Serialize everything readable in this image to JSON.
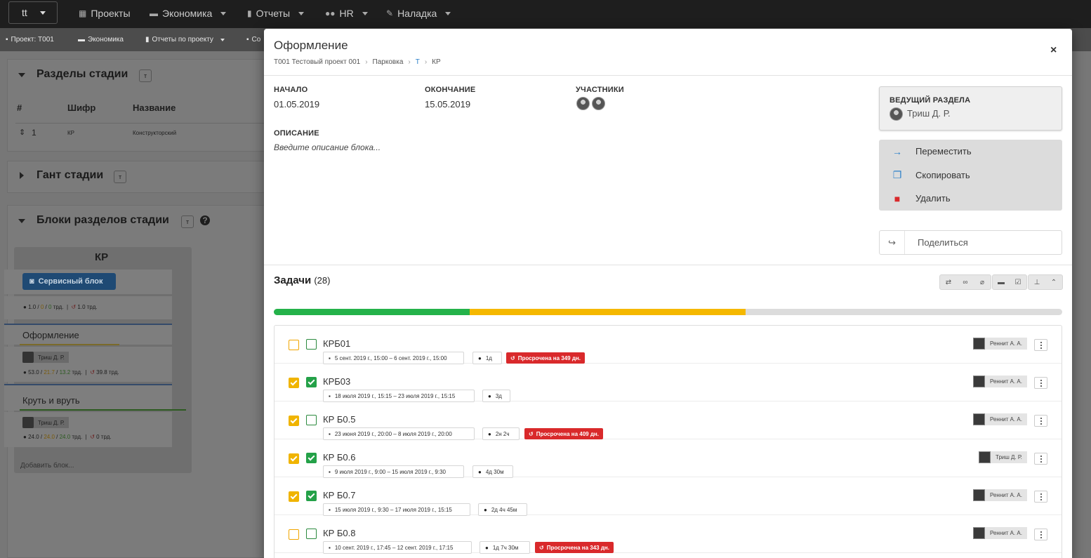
{
  "nav": {
    "project": "tt",
    "items": [
      {
        "icon": "grid-icon",
        "label": "Проекты",
        "dropdown": false
      },
      {
        "icon": "money-icon",
        "label": "Экономика",
        "dropdown": true
      },
      {
        "icon": "clipboard-icon",
        "label": "Отчеты",
        "dropdown": true
      },
      {
        "icon": "users-icon",
        "label": "HR",
        "dropdown": true
      },
      {
        "icon": "wrench-icon",
        "label": "Наладка",
        "dropdown": true
      }
    ]
  },
  "subnav": {
    "items": [
      "Проект: Т001",
      "Экономика",
      "Отчеты по проекту",
      "Co"
    ]
  },
  "background": {
    "sections_title": "Разделы стадии",
    "t_badge": "т",
    "table_headers": [
      "#",
      "Шифр",
      "Название"
    ],
    "row": {
      "num": "1",
      "code": "КР",
      "name": "Конструкторский"
    },
    "gantt_title": "Гант стадии",
    "blocks_title": "Блоки разделов стадии",
    "column_title": "КР",
    "service_block": "Сервисный блок",
    "svc_stats": {
      "a": "1.0",
      "b": "0",
      "c": "0",
      "unit": "трд.",
      "d": "1.0 трд."
    },
    "card1": {
      "title": "Оформление",
      "person": "Триш Д. Р.",
      "a": "53.0",
      "b": "21.7",
      "c": "13.2",
      "unit": "трд.",
      "d": "39.8 трд."
    },
    "card2": {
      "title": "Круть и вруть",
      "person": "Триш Д. Р.",
      "a": "24.0",
      "b": "24.0",
      "c": "24.0",
      "unit": "трд.",
      "d": "0 трд."
    },
    "add_block": "Добавить блок..."
  },
  "modal": {
    "title": "Оформление",
    "close": "×",
    "breadcrumbs": [
      "Т001 Тестовый проект 001",
      "Парковка",
      "Т",
      "КР"
    ],
    "start_label": "НАЧАЛО",
    "start_value": "01.05.2019",
    "end_label": "ОКОНЧАНИЕ",
    "end_value": "15.05.2019",
    "participants_label": "УЧАСТНИКИ",
    "description_label": "ОПИСАНИЕ",
    "description_placeholder": "Введите описание блока...",
    "lead_label": "ВЕДУЩИЙ РАЗДЕЛА",
    "lead_name": "Триш Д. Р.",
    "actions": [
      {
        "icon": "arrow-right-icon",
        "label": "Переместить",
        "color": "#2a7fc9"
      },
      {
        "icon": "copy-icon",
        "label": "Скопировать",
        "color": "#2a7fc9"
      },
      {
        "icon": "trash-icon",
        "label": "Удалить",
        "color": "#d9292b"
      }
    ],
    "share_label": "Поделиться",
    "tasks_title": "Задачи",
    "tasks_count": "(28)",
    "progress": {
      "done": 0.248,
      "in_progress": 0.35,
      "done_color": "#24b24a",
      "progress_color": "#f5b800"
    },
    "tasks": [
      {
        "name": "КРБ01",
        "orange_checked": false,
        "green_checked": false,
        "dates": "5 сент. 2019 г., 15:00 – 6 сент. 2019 г., 15:00",
        "duration": "1д",
        "overdue": "Просрочена на 349 дн.",
        "assignee": "Реннит А. А."
      },
      {
        "name": "КРБ03",
        "orange_checked": true,
        "green_checked": true,
        "dates": "18 июля 2019 г., 15:15 – 23 июля 2019 г., 15:15",
        "duration": "3д",
        "overdue": "",
        "assignee": "Реннит А. А."
      },
      {
        "name": "КР Б0.5",
        "orange_checked": true,
        "green_checked": false,
        "dates": "23 июня 2019 г., 20:00 – 8 июля 2019 г., 20:00",
        "duration": "2н 2ч",
        "overdue": "Просрочена на 409 дн.",
        "assignee": "Реннит А. А."
      },
      {
        "name": "КР Б0.6",
        "orange_checked": true,
        "green_checked": true,
        "dates": "9 июля 2019 г., 9:00 – 15 июля 2019 г., 9:30",
        "duration": "4д 30м",
        "overdue": "",
        "assignee": "Триш Д. Р."
      },
      {
        "name": "КР Б0.7",
        "orange_checked": true,
        "green_checked": true,
        "dates": "15 июля 2019 г., 9:30 – 17 июля 2019 г., 15:15",
        "duration": "2д 4ч 45м",
        "overdue": "",
        "assignee": "Реннит А. А."
      },
      {
        "name": "КР Б0.8",
        "orange_checked": false,
        "green_checked": false,
        "dates": "10 сент. 2019 г., 17:45 – 12 сент. 2019 г., 17:15",
        "duration": "1д 7ч 30м",
        "overdue": "Просрочена на 343 дн.",
        "assignee": "Реннит А. А."
      }
    ]
  }
}
